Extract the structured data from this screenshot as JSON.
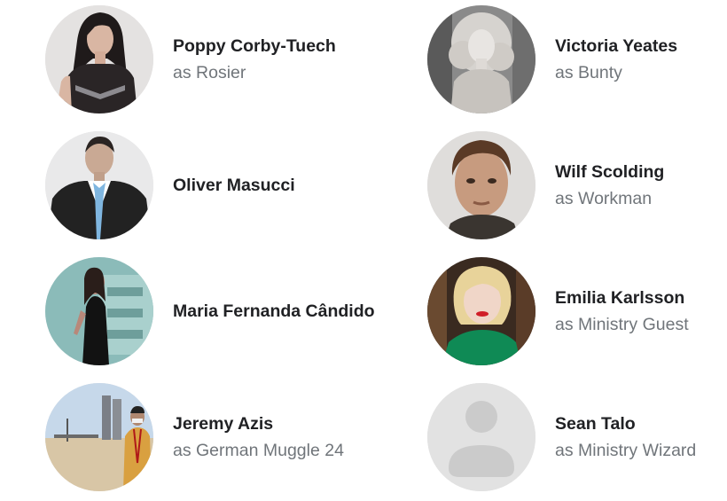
{
  "cast": [
    {
      "name": "Poppy Corby-Tuech",
      "role": "as Rosier",
      "photo": "woman-dark-hair-portrait"
    },
    {
      "name": "Victoria Yeates",
      "role": "as Bunty",
      "photo": "woman-curly-hair-bw-portrait"
    },
    {
      "name": "Oliver Masucci",
      "role": "",
      "photo": "man-suit-blue-tie-portrait"
    },
    {
      "name": "Wilf Scolding",
      "role": "as Workman",
      "photo": "man-brown-hair-portrait"
    },
    {
      "name": "Maria Fernanda Cândido",
      "role": "",
      "photo": "woman-black-dress-portrait"
    },
    {
      "name": "Emilia Karlsson",
      "role": "as Ministry Guest",
      "photo": "woman-blonde-green-top-portrait"
    },
    {
      "name": "Jeremy Azis",
      "role": "as German Muggle 24",
      "photo": "man-outdoor-desert-photo"
    },
    {
      "name": "Sean Talo",
      "role": "as Ministry Wizard",
      "photo": "default-person-placeholder"
    }
  ]
}
